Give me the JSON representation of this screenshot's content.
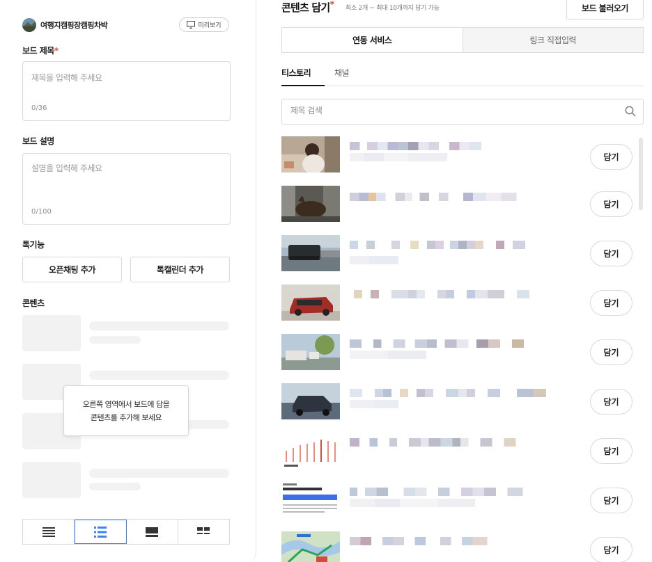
{
  "left": {
    "blog_name": "여행지캠핑장캠핑차박",
    "preview_label": "미리보기",
    "board_title": {
      "label": "보드 제목",
      "required_mark": "*",
      "placeholder": "제목을 입력해 주세요",
      "counter": "0/36"
    },
    "board_desc": {
      "label": "보드 설명",
      "placeholder": "설명을 입력해 주세요",
      "counter": "0/100"
    },
    "talk_features": {
      "label": "톡기능",
      "open_chat_button": "오픈채팅 추가",
      "talk_calendar_button": "톡캘린더 추가"
    },
    "contents": {
      "label": "콘텐츠",
      "empty_tooltip_line1": "오른쪽 영역에서 보드에 담을",
      "empty_tooltip_line2": "콘텐츠를 추가해 보세요"
    },
    "layout_options": [
      "list-compact-icon",
      "list-detail-icon",
      "card-wide-icon",
      "grid-icon"
    ],
    "active_layout_index": 1
  },
  "right": {
    "title": "콘텐츠 담기",
    "required_mark": "*",
    "subtitle": "최소 2개 ~ 최대 10개까지 담기 가능",
    "load_board_button": "보드 불러오기",
    "source_tabs": [
      "연동 서비스",
      "링크 직접입력"
    ],
    "active_source_tab": 0,
    "channel_tabs": [
      "티스토리",
      "채널"
    ],
    "active_channel_tab": 0,
    "search_placeholder": "제목 검색",
    "add_label": "담기",
    "items_count_visible": 9
  },
  "colors": {
    "accent_blue": "#3b82f6",
    "required_red": "#e34a3c",
    "border": "#d9d9d9",
    "skeleton": "#f2f2f2"
  }
}
